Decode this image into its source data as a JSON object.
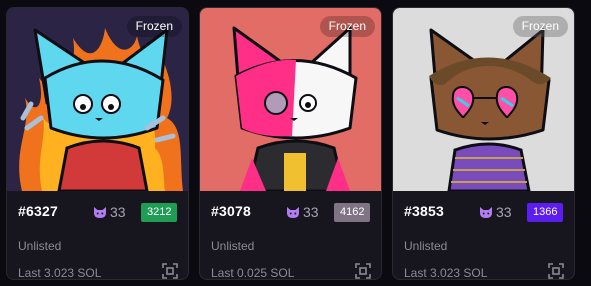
{
  "cards": [
    {
      "id": "#6327",
      "score": "33",
      "rank": "3212",
      "rank_color": "#1f9d55",
      "badge": "Frozen",
      "status": "Unlisted",
      "last": "Last 3.023 SOL",
      "bg_color": "#2b2445",
      "icon": "scan-icon"
    },
    {
      "id": "#3078",
      "score": "33",
      "rank": "4162",
      "rank_color": "#7e7486",
      "badge": "Frozen",
      "status": "Unlisted",
      "last": "Last 0.025 SOL",
      "bg_color": "#e26c66",
      "icon": "scan-icon"
    },
    {
      "id": "#3853",
      "score": "33",
      "rank": "1366",
      "rank_color": "#5b1df0",
      "badge": "Frozen",
      "status": "Unlisted",
      "last": "Last 3.023 SOL",
      "bg_color": "#dcdcdc",
      "icon": "scan-icon"
    }
  ],
  "colors": {
    "page_bg": "#0a0a10",
    "card_bg": "#17161f",
    "fox_icon": "#b37cf0"
  }
}
